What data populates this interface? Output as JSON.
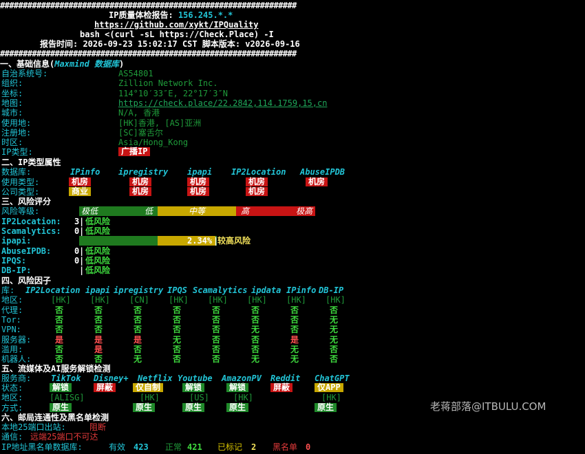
{
  "header": {
    "hash_line": "#################################################################",
    "title_prefix": "IP质量体检报告: ",
    "title_ip": "156.245.*.*",
    "repo_link": "https://github.com/xykt/IPQuality",
    "command": "bash <(curl -sL https://Check.Place) -I",
    "report_time": "报告时间: 2026-09-23 15:02:17 CST  脚本版本: v2026-09-16"
  },
  "basic": {
    "heading_prefix": "一、基础信息(",
    "heading_source": "Maxmind 数据库",
    "heading_suffix": ")",
    "fields": [
      {
        "label": "自治系统号:",
        "value": "AS54801"
      },
      {
        "label": "组织:",
        "value": "Zillion Network Inc."
      },
      {
        "label": "坐标:",
        "value": "114°10′33″E, 22°17′3″N"
      },
      {
        "label": "地图:",
        "value": "https://check.place/22.2842,114.1759,15,cn"
      },
      {
        "label": "城市:",
        "value": "N/A, 香港"
      },
      {
        "label": "使用地:",
        "value": "[HK]香港, [AS]亚洲"
      },
      {
        "label": "注册地:",
        "value": "[SC]塞舌尔"
      },
      {
        "label": "时区:",
        "value": "Asia/Hong_Kong"
      }
    ],
    "ip_type_label": "IP类型:",
    "ip_type_value": "广播IP"
  },
  "types": {
    "heading": "二、IP类型属性",
    "db_label": "数据库:",
    "usage_label": "使用类型:",
    "company_label": "公司类型:",
    "dbs": [
      "IPinfo",
      "ipregistry",
      "ipapi",
      "IP2Location",
      "AbuseIPDB"
    ],
    "usage": [
      "机房",
      "机房",
      "机房",
      "机房",
      "机房"
    ],
    "company": [
      "商业",
      "机房",
      "机房",
      "机房",
      ""
    ]
  },
  "risk": {
    "heading": "三、风险评分",
    "level_label": "风险等级:",
    "levels": [
      "极低",
      "低",
      "中等",
      "高",
      "极高"
    ],
    "scores": [
      {
        "label": "IP2Location:",
        "score": "3",
        "text": "低风险"
      },
      {
        "label": "Scamalytics:",
        "score": "0",
        "text": "低风险"
      },
      {
        "label": "ipapi:",
        "score": "2.34%",
        "text": "较高风险"
      },
      {
        "label": "AbuseIPDB:",
        "score": "0",
        "text": "低风险"
      },
      {
        "label": "IPQS:",
        "score": "0",
        "text": "低风险"
      },
      {
        "label": "DB-IP:",
        "score": "",
        "text": "低风险"
      }
    ]
  },
  "factors": {
    "heading": "四、风险因子",
    "lib_label": "库:",
    "libs": [
      "IP2Location",
      "ipapi",
      "ipregistry",
      "IPQS",
      "Scamalytics",
      "ipdata",
      "IPinfo",
      "DB-IP"
    ],
    "rows": [
      {
        "label": "地区:",
        "cells": [
          "[HK]",
          "[HK]",
          "[CN]",
          "[HK]",
          "[HK]",
          "[HK]",
          "[HK]",
          "[HK]"
        ]
      },
      {
        "label": "代理:",
        "cells": [
          "否",
          "否",
          "否",
          "否",
          "否",
          "否",
          "否",
          "否"
        ]
      },
      {
        "label": "Tor:",
        "cells": [
          "否",
          "否",
          "否",
          "否",
          "否",
          "否",
          "否",
          "无"
        ]
      },
      {
        "label": "VPN:",
        "cells": [
          "否",
          "否",
          "否",
          "否",
          "否",
          "无",
          "否",
          "无"
        ]
      },
      {
        "label": "服务器:",
        "cells": [
          "是",
          "是",
          "是",
          "无",
          "否",
          "否",
          "是",
          "无"
        ]
      },
      {
        "label": "滥用:",
        "cells": [
          "否",
          "是",
          "否",
          "否",
          "否",
          "否",
          "无",
          "否"
        ]
      },
      {
        "label": "机器人:",
        "cells": [
          "否",
          "否",
          "无",
          "否",
          "否",
          "无",
          "无",
          "否"
        ]
      }
    ]
  },
  "streaming": {
    "heading": "五、流媒体及AI服务解锁检测",
    "service_label": "服务商:",
    "status_label": "状态:",
    "region_label": "地区:",
    "method_label": "方式:",
    "services": [
      "TikTok",
      "Disney+",
      "Netflix",
      "Youtube",
      "AmazonPV",
      "Reddit",
      "ChatGPT"
    ],
    "status": [
      "解锁",
      "屏蔽",
      "仅自制",
      "解锁",
      "解锁",
      "屏蔽",
      "仅APP"
    ],
    "regions": [
      "[ALISG]",
      "",
      "[HK]",
      "[US]",
      "[HK]",
      "",
      "[HK]"
    ],
    "methods": [
      "原生",
      "",
      "原生",
      "原生",
      "原生",
      "",
      "原生"
    ]
  },
  "mail": {
    "heading": "六、邮局连通性及黑名单检测",
    "port_label": "本地25端口出站:",
    "port_value": "阻断",
    "conn_label": "通信:",
    "conn_value": "远端25端口不可达",
    "bl_label": "IP地址黑名单数据库:",
    "valid_label": "有效",
    "valid_value": "423",
    "normal_label": "正常",
    "normal_value": "421",
    "marked_label": "已标记",
    "marked_value": "2",
    "black_label": "黑名单",
    "black_value": "0"
  },
  "watermark": "老蒋部落@ITBULU.COM"
}
